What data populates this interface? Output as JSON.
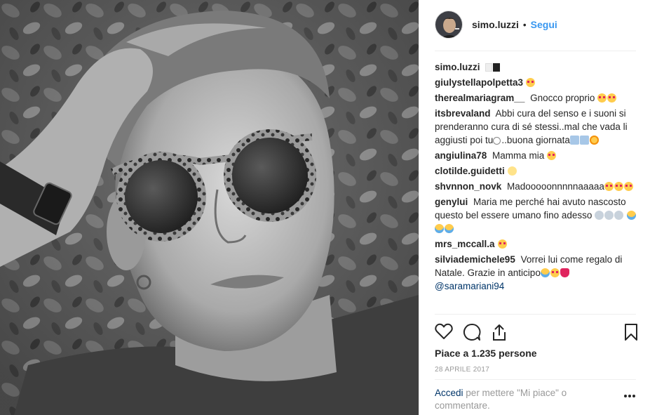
{
  "post": {
    "username": "simo.luzzi",
    "separator": "•",
    "follow_label": "Segui"
  },
  "comments": [
    {
      "user": "simo.luzzi",
      "text": "",
      "emoji": []
    },
    {
      "user": "giulystellapolpetta3",
      "text": "",
      "emoji": [
        "heart-eyes"
      ]
    },
    {
      "user": "therealmariagram__",
      "text": "Gnocco proprio",
      "emoji": [
        "heart-eyes",
        "heart-eyes"
      ]
    },
    {
      "user": "itsbrevaland",
      "text": "Abbi cura del senso e i suoni si prenderanno cura di sé stessi..mal che vada li aggiusti poi tu",
      "text2": "..buona giornata",
      "emoji": [
        "musical-note",
        "musical-note",
        "sunflower"
      ]
    },
    {
      "user": "angiulina78",
      "text": "Mamma mia",
      "emoji": [
        "heart-eyes"
      ]
    },
    {
      "user": "clotilde.guidetti",
      "text": "",
      "emoji": [
        "dizzy"
      ]
    },
    {
      "user": "shvnnon_novk",
      "text": "Madooooonnnnnaaaaa",
      "emoji": [
        "heart-eyes",
        "heart-eyes",
        "heart-eyes"
      ]
    },
    {
      "user": "genylui",
      "text": "Maria me perché hai avuto nascosto questo bel essere umano fino adesso",
      "emoji": [
        "scream",
        "scream",
        "scream",
        "tears-of-joy",
        "tears-of-joy",
        "tears-of-joy"
      ]
    },
    {
      "user": "mrs_mccall.a",
      "text": "",
      "emoji": [
        "heart-eyes"
      ]
    },
    {
      "user": "silviademichele95",
      "text": "Vorrei lui come regalo di Natale. Grazie in anticipo",
      "emoji": [
        "tears-of-joy",
        "heart-eyes",
        "red-heart"
      ],
      "mention": "@saramariani94"
    }
  ],
  "actions": {
    "like_icon": "heart-outline-icon",
    "comment_icon": "comment-bubble-icon",
    "share_icon": "share-upload-icon",
    "save_icon": "bookmark-icon"
  },
  "likes_text": "Piace a 1.235 persone",
  "date_text": "28 APRILE 2017",
  "login": {
    "link": "Accedi",
    "rest": "per mettere \"Mi piace\" o commentare."
  },
  "colors": {
    "link_blue": "#3897f0",
    "mention_blue": "#003569",
    "muted": "#999999",
    "divider": "#efefef"
  }
}
